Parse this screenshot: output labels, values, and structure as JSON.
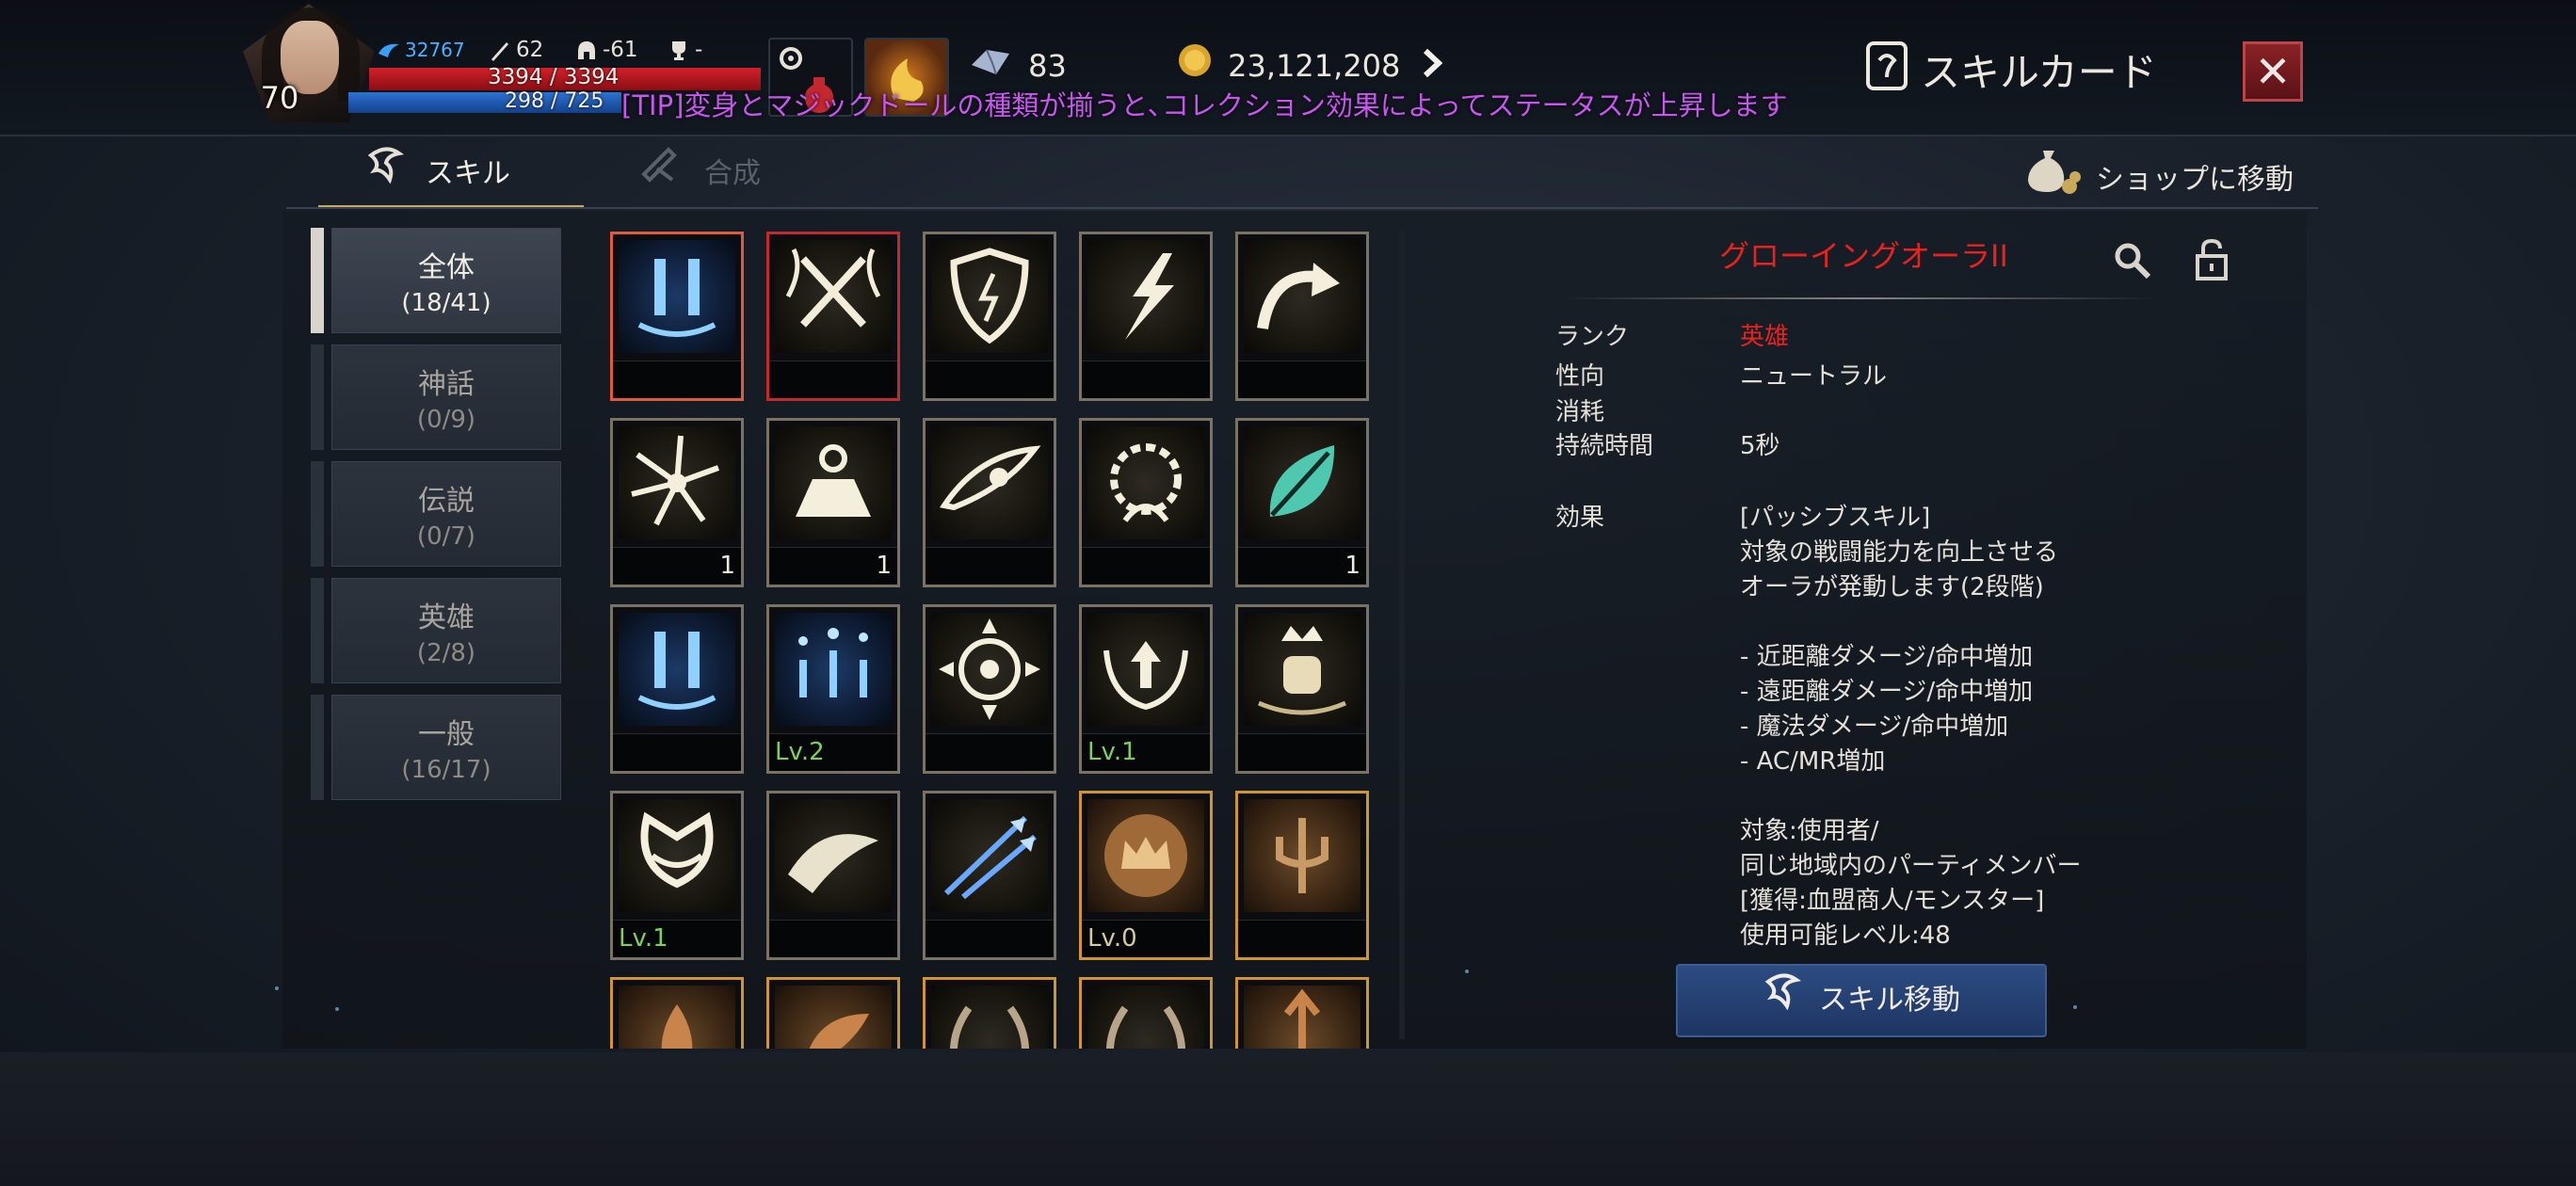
{
  "hud": {
    "level": "70",
    "exp_value": "32767",
    "attack": "62",
    "defense": "-61",
    "trophy": "-",
    "hp_text": "3394 / 3394",
    "mp_text": "298 / 725",
    "crystals": "83",
    "gold": "23,121,208",
    "tip": "[TIP]変身とマジックドールの種類が揃うと､コレクション効果によってステータスが上昇します"
  },
  "window": {
    "title": "スキルカード"
  },
  "tabs": [
    {
      "label": "スキル",
      "active": true
    },
    {
      "label": "合成",
      "active": false
    }
  ],
  "shop_label": "ショップに移動",
  "categories": [
    {
      "name": "全体",
      "count": "(18/41)",
      "active": true
    },
    {
      "name": "神話",
      "count": "(0/9)",
      "active": false
    },
    {
      "name": "伝説",
      "count": "(0/7)",
      "active": false
    },
    {
      "name": "英雄",
      "count": "(2/8)",
      "active": false
    },
    {
      "name": "一般",
      "count": "(16/17)",
      "active": false
    }
  ],
  "cards": [
    {
      "icon": "blue-pillar-icon",
      "style": "blue",
      "border": "selected",
      "qty": "",
      "lv": ""
    },
    {
      "icon": "crossed-swords-icon",
      "style": "dark",
      "border": "red",
      "qty": "",
      "lv": ""
    },
    {
      "icon": "shield-icon",
      "style": "dark",
      "border": "normal",
      "qty": "",
      "lv": ""
    },
    {
      "icon": "lightning-icon",
      "style": "dark",
      "border": "normal",
      "qty": "",
      "lv": ""
    },
    {
      "icon": "curved-arrow-icon",
      "style": "dark",
      "border": "normal",
      "qty": "",
      "lv": ""
    },
    {
      "icon": "burst-icon",
      "style": "dark",
      "border": "normal",
      "qty": "1",
      "lv": ""
    },
    {
      "icon": "weight-icon",
      "style": "dark",
      "border": "normal",
      "qty": "1",
      "lv": ""
    },
    {
      "icon": "eye-icon",
      "style": "dark",
      "border": "normal",
      "qty": "",
      "lv": ""
    },
    {
      "icon": "spiked-gear-icon",
      "style": "dark",
      "border": "normal",
      "qty": "",
      "lv": ""
    },
    {
      "icon": "teal-leaf-icon",
      "style": "dark",
      "border": "normal",
      "qty": "1",
      "lv": ""
    },
    {
      "icon": "blue-pillar-icon",
      "style": "blue",
      "border": "normal",
      "qty": "",
      "lv": ""
    },
    {
      "icon": "blue-sparkle-icon",
      "style": "blue",
      "border": "normal",
      "qty": "",
      "lv": "Lv.2"
    },
    {
      "icon": "target-icon",
      "style": "dark",
      "border": "normal",
      "qty": "",
      "lv": ""
    },
    {
      "icon": "arrow-up-wings-icon",
      "style": "dark",
      "border": "normal",
      "qty": "",
      "lv": "Lv.1"
    },
    {
      "icon": "crown-fist-icon",
      "style": "dark",
      "border": "normal",
      "qty": "",
      "lv": ""
    },
    {
      "icon": "wings-icon",
      "style": "dark",
      "border": "normal",
      "qty": "",
      "lv": "Lv.1"
    },
    {
      "icon": "feather-icon",
      "style": "dark",
      "border": "normal",
      "qty": "",
      "lv": ""
    },
    {
      "icon": "blue-arrows-icon",
      "style": "dark",
      "border": "normal",
      "qty": "",
      "lv": ""
    },
    {
      "icon": "bronze-crown-icon",
      "style": "bronze",
      "border": "gold",
      "qty": "",
      "lv": "Lv.0"
    },
    {
      "icon": "trident-icon",
      "style": "bronze",
      "border": "gold",
      "qty": "",
      "lv": ""
    },
    {
      "icon": "flame-icon",
      "style": "bronze",
      "border": "gold",
      "qty": "",
      "lv": ""
    },
    {
      "icon": "wing-icon",
      "style": "bronze",
      "border": "gold",
      "qty": "",
      "lv": ""
    },
    {
      "icon": "laurel-icon",
      "style": "dark",
      "border": "gold",
      "qty": "",
      "lv": ""
    },
    {
      "icon": "laurel-icon",
      "style": "dark",
      "border": "gold",
      "qty": "",
      "lv": ""
    },
    {
      "icon": "spear-icon",
      "style": "bronze",
      "border": "gold",
      "qty": "",
      "lv": ""
    }
  ],
  "detail": {
    "name": "グローイングオーラII",
    "rank_label": "ランク",
    "rank_value": "英雄",
    "alignment_label": "性向",
    "alignment_value": "ニュートラル",
    "cost_label": "消耗",
    "duration_label": "持続時間",
    "duration_value": "5秒",
    "effect_label": "効果",
    "description": [
      "[パッシブスキル]",
      "対象の戦闘能力を向上させる",
      "オーラが発動します(2段階)",
      "",
      "-  近距離ダメージ/命中増加",
      "-  遠距離ダメージ/命中増加",
      "-  魔法ダメージ/命中増加",
      "-  AC/MR増加",
      "",
      "対象:使用者/",
      "同じ地域内のパーティメンバー",
      "[獲得:血盟商人/モンスター]",
      "使用可能レベル:48"
    ],
    "move_button": "スキル移動"
  },
  "colors": {
    "rank_red": "#e8221e",
    "level_green": "#7ed05a",
    "tip_purple": "#c855f0",
    "selected_border": "#e05a3e",
    "gold_border": "#d0952e"
  }
}
